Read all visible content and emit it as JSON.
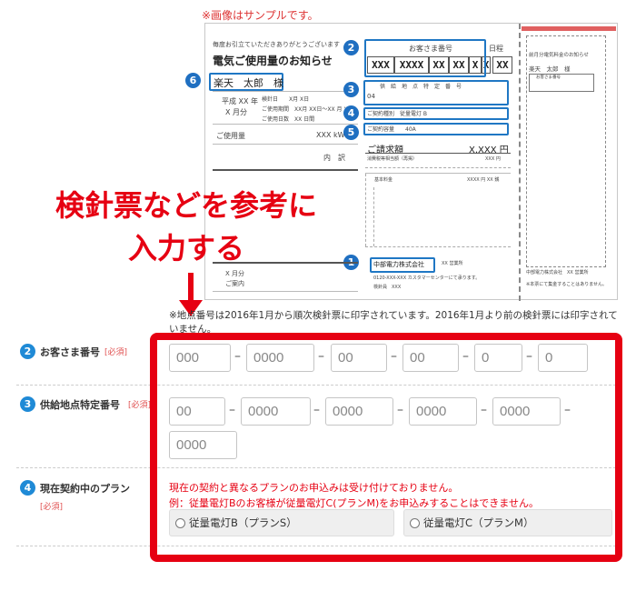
{
  "sample_note": "※画像はサンプルです。",
  "sheet": {
    "greeting": "毎度お引立ていただきありがとうございます",
    "title": "電気ご使用量のお知らせ",
    "customer_label": "お客さま番号",
    "date_label": "日程",
    "customer_number_boxes": [
      "XXX",
      "XXXX",
      "XX",
      "XX",
      "X",
      "X",
      "XX"
    ],
    "supply_label": "供　給　地　点　特　定　番　号",
    "supply_first": "04",
    "contract_type": "ご契約種別　従量電灯 B",
    "contract_capacity": "ご契約容量　　40A",
    "name": "楽天　太郎　様",
    "era": "平成 XX 年",
    "month": "X 月分",
    "meter_lines": [
      "検針日　　X月 X日",
      "ご使用期間　XX月 XX日～XX 月 X",
      "ご使用日数　XX 日間"
    ],
    "usage_label": "ご使用量",
    "usage_value": "XXX kW",
    "breakdown": "内　訳",
    "billing_label": "ご請求額",
    "billing_value": "X,XXX 円",
    "tax_line": "消費税等相当額（再掲）",
    "tax_value": "XXX 円",
    "base_fee": "基本料金",
    "base_value": "XXXX 円 XX 銭",
    "company": "中部電力株式会社",
    "office": "XX 営業所",
    "tel": "0120-XXX-XXX カスタマーセンターにて承ります。",
    "meter_no": "検針員　XXX",
    "bottom_month": "X 月分",
    "bottom_info": "ご案内",
    "side_title": "前月分電気料金のお知らせ",
    "side_name": "楽天　太郎　様",
    "side_customer": "お客さま番号",
    "side_company": "中部電力株式会社　XX 営業所",
    "side_note": "※本票にて集金することはありません。",
    "badges": [
      "1",
      "2",
      "3",
      "4",
      "5",
      "6"
    ]
  },
  "overlay": {
    "line1": "検針票などを参考に",
    "line2": "入力する"
  },
  "footnote": "※地点番号は2016年1月から順次検針票に印字されています。2016年1月より前の検針票には印字されていません。",
  "form": {
    "customer_number": {
      "step": "2",
      "label": "お客さま番号",
      "required": "[必須]",
      "placeholders": [
        "000",
        "0000",
        "00",
        "00",
        "0",
        "0"
      ]
    },
    "supply_point": {
      "step": "3",
      "label": "供給地点特定番号",
      "required": "[必須]",
      "placeholders": [
        "00",
        "0000",
        "0000",
        "0000",
        "0000",
        "0000"
      ]
    },
    "plan": {
      "step": "4",
      "label": "現在契約中のプラン",
      "required": "[必須]",
      "warning1": "現在の契約と異なるプランのお申込みは受け付けておりません。",
      "warning2": "例：従量電灯Bのお客様が従量電灯C(プランM)をお申込みすることはできません。",
      "option_b": "従量電灯B（プランS）",
      "option_c": "従量電灯C（プランM）"
    }
  },
  "colors": {
    "accent_red": "#e60012",
    "badge_blue": "#1f8ad6"
  }
}
